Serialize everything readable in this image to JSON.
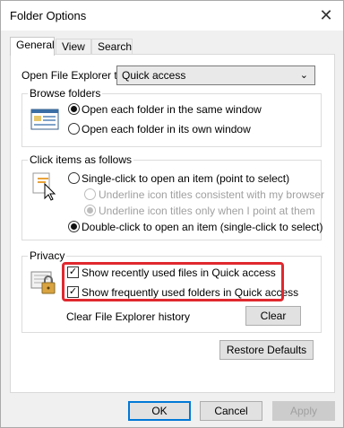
{
  "window": {
    "title": "Folder Options"
  },
  "tabs": [
    {
      "label": "General",
      "active": true
    },
    {
      "label": "View",
      "active": false
    },
    {
      "label": "Search",
      "active": false
    }
  ],
  "open_explorer": {
    "label": "Open File Explorer to:",
    "selected": "Quick access"
  },
  "browse_folders": {
    "title": "Browse folders",
    "options": [
      {
        "label": "Open each folder in the same window",
        "checked": true
      },
      {
        "label": "Open each folder in its own window",
        "checked": false
      }
    ]
  },
  "click_items": {
    "title": "Click items as follows",
    "single_click": "Single-click to open an item (point to select)",
    "underline_consistent": "Underline icon titles consistent with my browser",
    "underline_point": "Underline icon titles only when I point at them",
    "double_click": "Double-click to open an item (single-click to select)"
  },
  "privacy": {
    "title": "Privacy",
    "show_recent_files": "Show recently used files in Quick access",
    "show_frequent_folders": "Show frequently used folders in Quick access",
    "clear_history_label": "Clear File Explorer history",
    "clear_button": "Clear"
  },
  "buttons": {
    "restore_defaults": "Restore Defaults",
    "ok": "OK",
    "cancel": "Cancel",
    "apply": "Apply"
  },
  "colors": {
    "highlight_border": "#e0282e",
    "primary_button_border": "#0078d7"
  }
}
